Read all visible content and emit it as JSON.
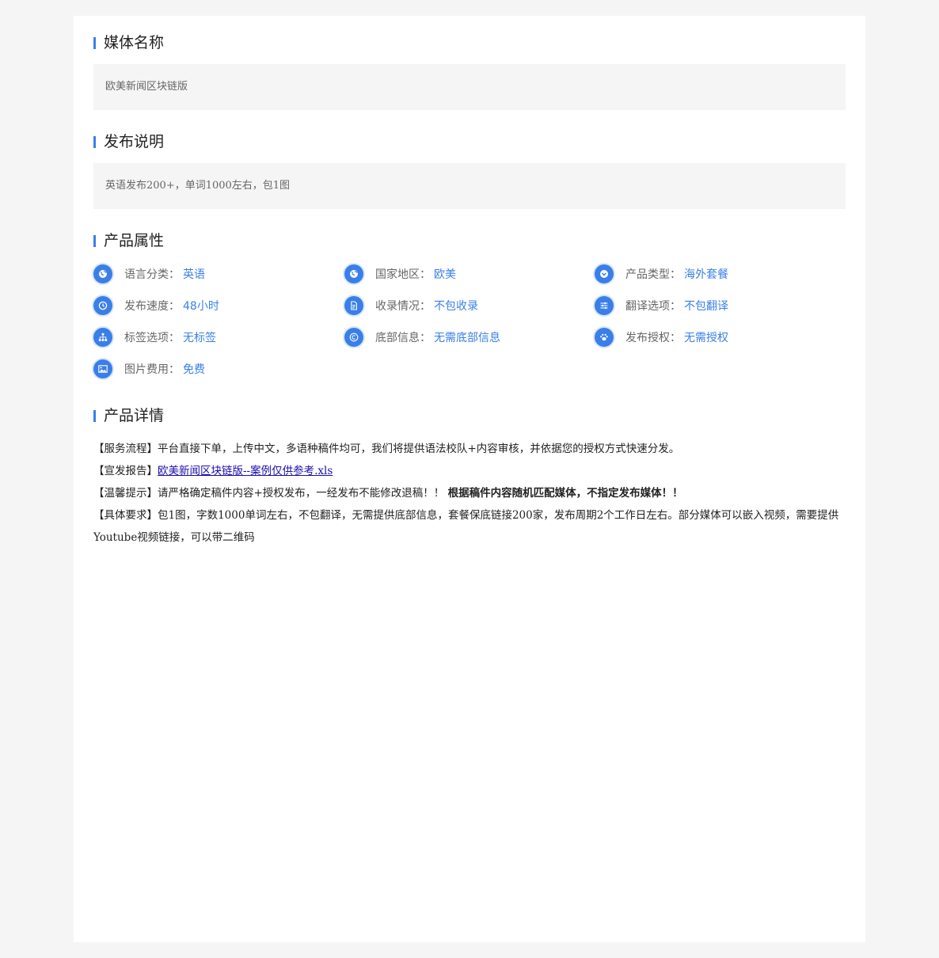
{
  "sections": {
    "media_name": {
      "title": "媒体名称",
      "value": "欧美新闻区块链版"
    },
    "publish_desc": {
      "title": "发布说明",
      "value": "英语发布200+，单词1000左右，包1图"
    },
    "attributes": {
      "title": "产品属性",
      "colon": "：",
      "items": [
        {
          "label": "语言分类",
          "value": "英语",
          "icon": "globe-icon"
        },
        {
          "label": "国家地区",
          "value": "欧美",
          "icon": "globe-icon"
        },
        {
          "label": "产品类型",
          "value": "海外套餐",
          "icon": "chevron-down-circle-icon"
        },
        {
          "label": "发布速度",
          "value": "48小时",
          "icon": "clock-icon"
        },
        {
          "label": "收录情况",
          "value": "不包收录",
          "icon": "document-icon"
        },
        {
          "label": "翻译选项",
          "value": "不包翻译",
          "icon": "sliders-icon"
        },
        {
          "label": "标签选项",
          "value": "无标签",
          "icon": "sitemap-icon"
        },
        {
          "label": "底部信息",
          "value": "无需底部信息",
          "icon": "copyright-icon"
        },
        {
          "label": "发布授权",
          "value": "无需授权",
          "icon": "paw-icon"
        },
        {
          "label": "图片费用",
          "value": "免费",
          "icon": "image-icon"
        }
      ]
    },
    "detail": {
      "title": "产品详情",
      "service_tag": "【服务流程】",
      "service_text": "平台直接下单，上传中文，多语种稿件均可，我们将提供语法校队+内容审核，并依据您的授权方式快速分发。",
      "report_tag": "【宣发报告】",
      "report_link": "欧美新闻区块链版--案例仅供参考.xls",
      "tip_tag": "【温馨提示】",
      "tip_text": "请严格确定稿件内容+授权发布，一经发布不能修改退稿！！",
      "tip_bold": "根据稿件内容随机匹配媒体，不指定发布媒体！！",
      "req_tag": "【具体要求】",
      "req_text": "包1图，字数1000单词左右，不包翻译，无需提供底部信息，套餐保底链接200家，发布周期2个工作日左右。部分媒体可以嵌入视频，需要提供Youtube视频链接，可以带二维码"
    }
  },
  "colors": {
    "accent": "#3a7fe8",
    "box_bg": "#f5f5f5"
  }
}
